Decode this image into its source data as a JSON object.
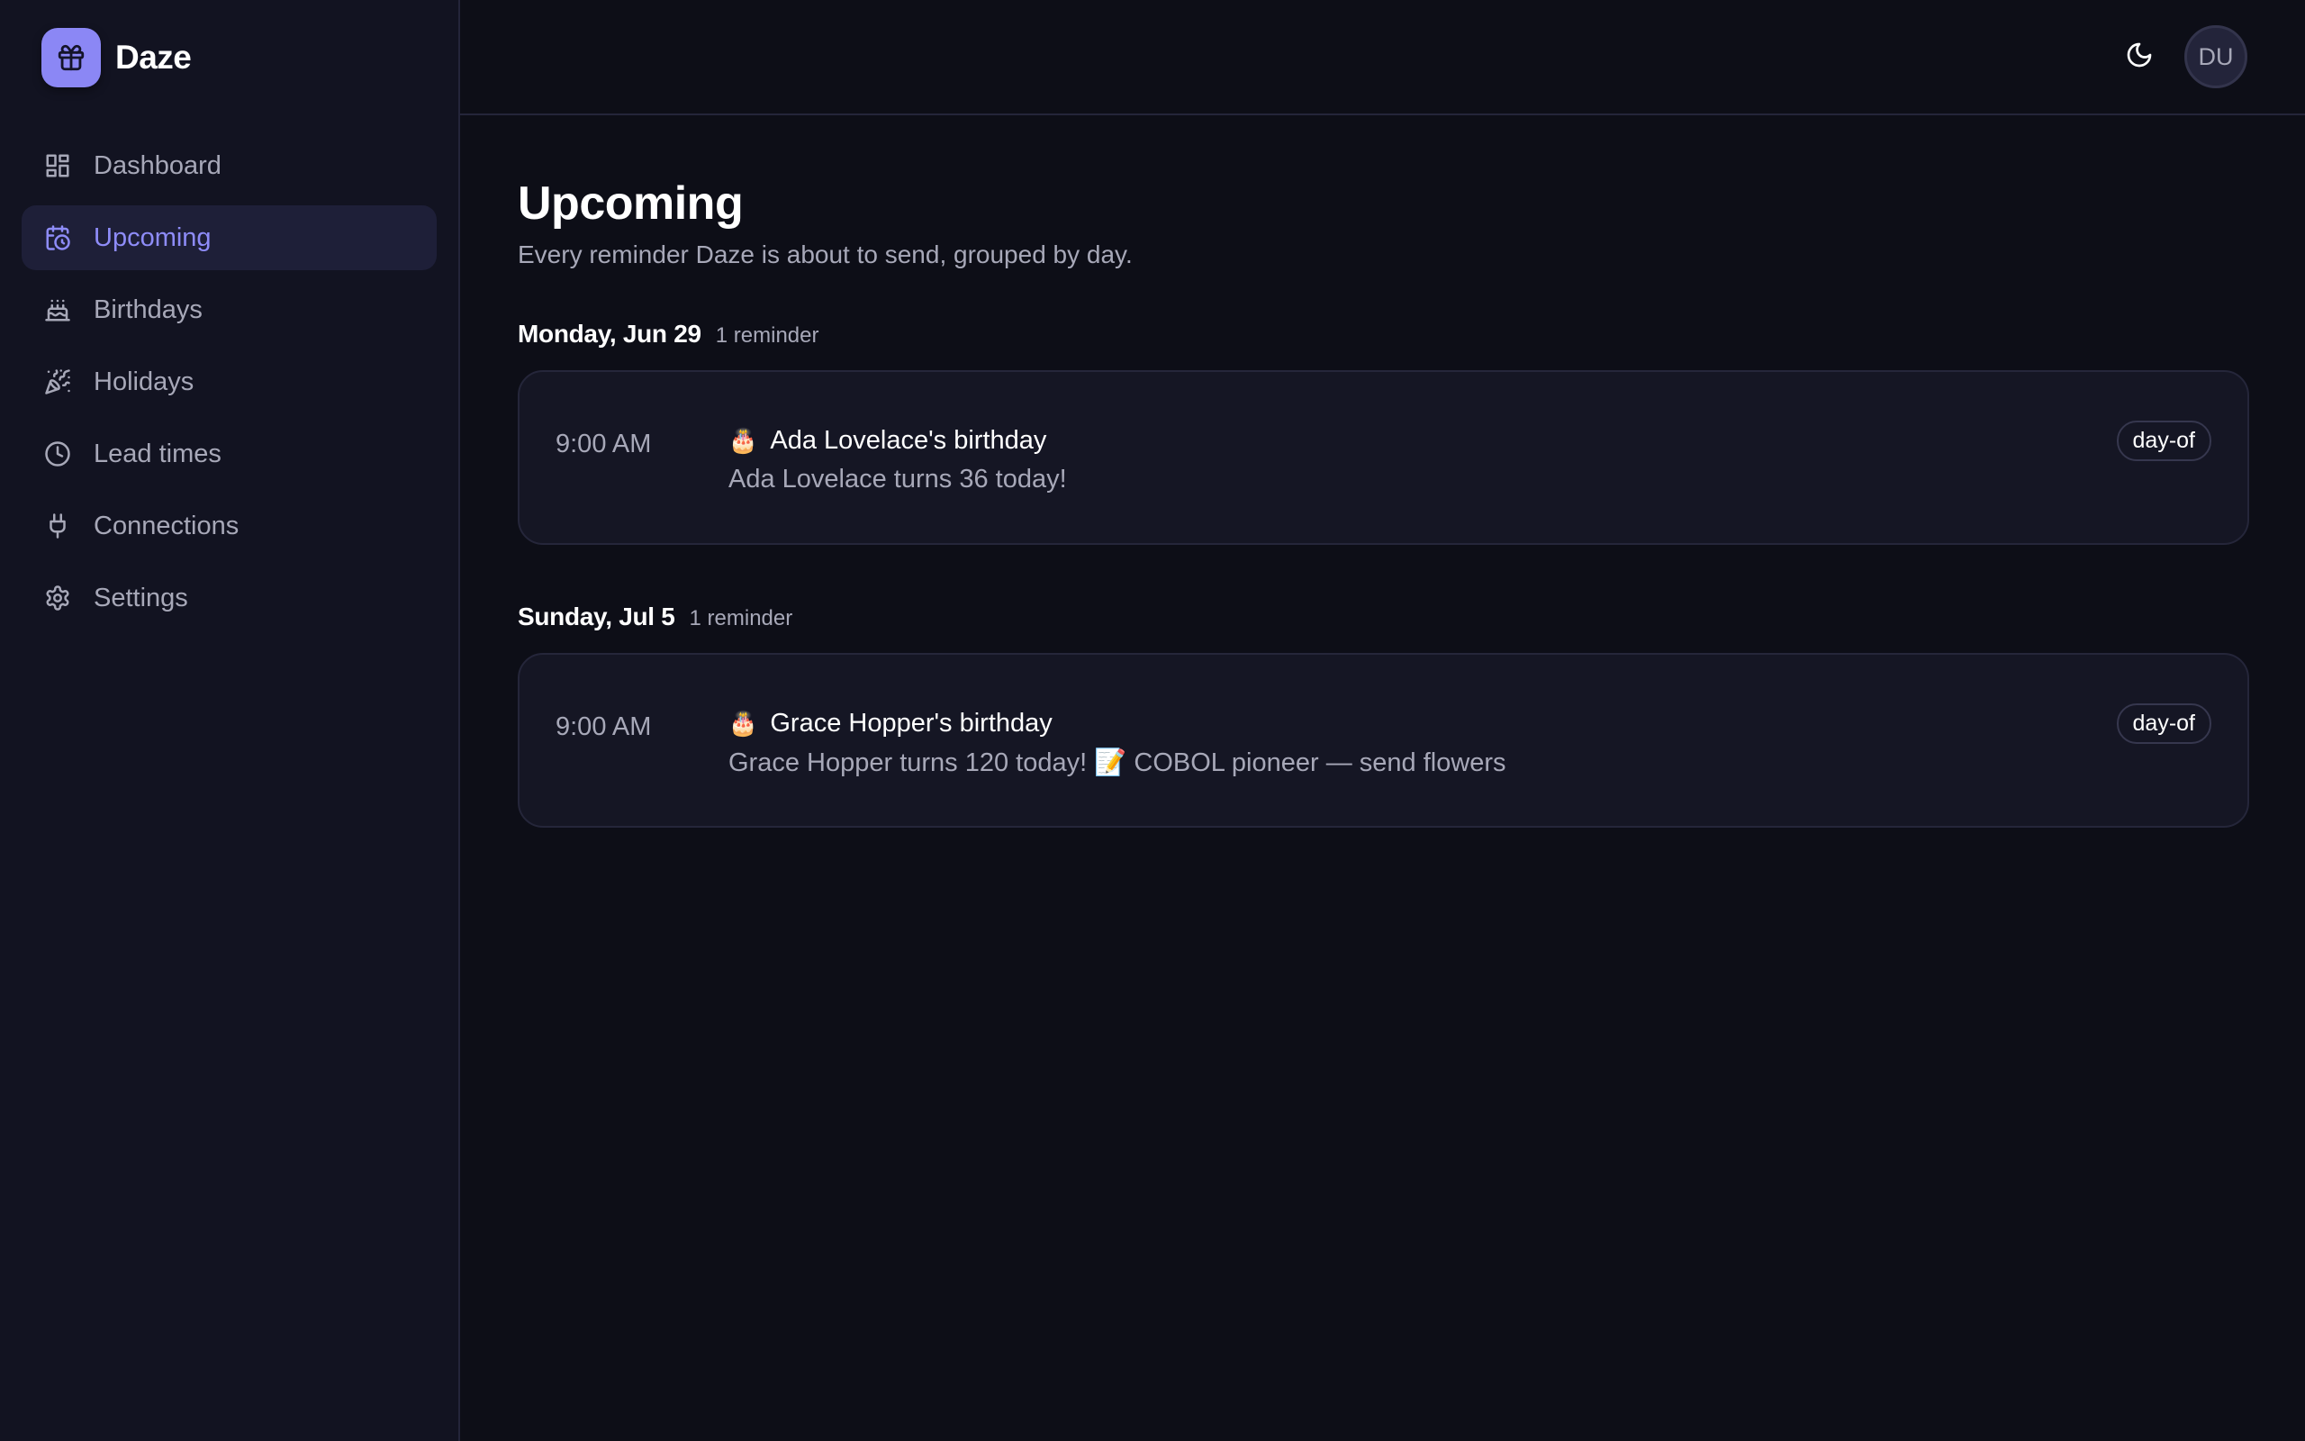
{
  "app": {
    "name": "Daze"
  },
  "sidebar": {
    "items": [
      {
        "label": "Dashboard",
        "icon": "dashboard-icon",
        "active": false
      },
      {
        "label": "Upcoming",
        "icon": "calendar-clock-icon",
        "active": true
      },
      {
        "label": "Birthdays",
        "icon": "cake-icon",
        "active": false
      },
      {
        "label": "Holidays",
        "icon": "party-popper-icon",
        "active": false
      },
      {
        "label": "Lead times",
        "icon": "clock-icon",
        "active": false
      },
      {
        "label": "Connections",
        "icon": "plug-icon",
        "active": false
      },
      {
        "label": "Settings",
        "icon": "gear-icon",
        "active": false
      }
    ]
  },
  "topbar": {
    "theme_icon": "moon-icon",
    "avatar_initials": "DU"
  },
  "page": {
    "title": "Upcoming",
    "subtitle": "Every reminder Daze is about to send, grouped by day."
  },
  "groups": [
    {
      "date": "Monday, Jun 29",
      "count": "1 reminder",
      "reminders": [
        {
          "time": "9:00 AM",
          "emoji": "🎂",
          "title": "Ada Lovelace's birthday",
          "description": "Ada Lovelace turns 36 today!",
          "badge": "day-of"
        }
      ]
    },
    {
      "date": "Sunday, Jul 5",
      "count": "1 reminder",
      "reminders": [
        {
          "time": "9:00 AM",
          "emoji": "🎂",
          "title": "Grace Hopper's birthday",
          "description": "Grace Hopper turns 120 today! 📝 COBOL pioneer — send flowers",
          "badge": "day-of"
        }
      ]
    }
  ],
  "colors": {
    "accent": "#8e8cf8",
    "brand_logo": "#8b87f5",
    "background": "#0d0e17",
    "sidebar": "#121321",
    "card": "#151624"
  }
}
